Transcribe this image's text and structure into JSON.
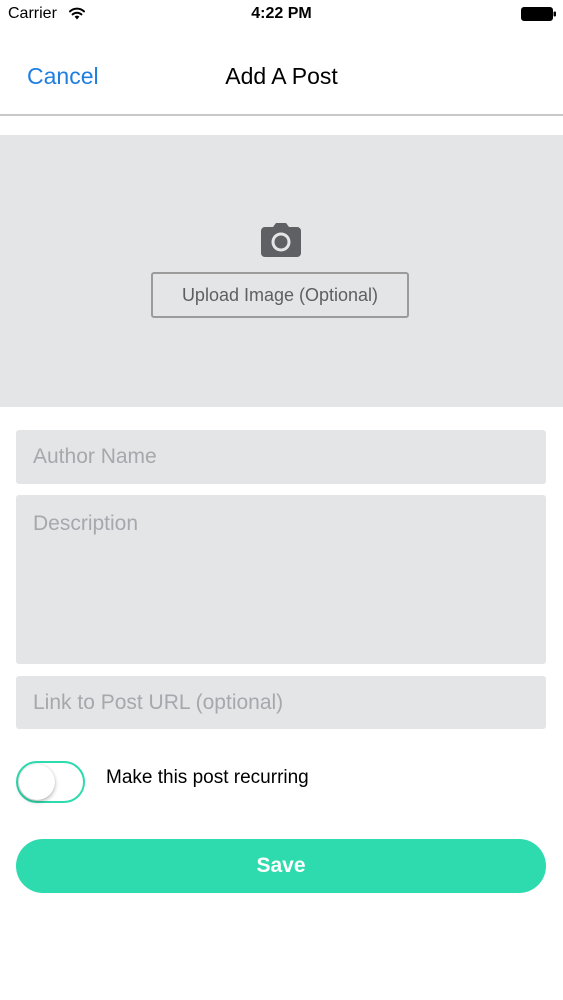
{
  "status_bar": {
    "carrier": "Carrier",
    "time": "4:22 PM",
    "wifi_icon": "wifi-icon",
    "battery_icon": "battery-icon"
  },
  "nav": {
    "cancel_label": "Cancel",
    "title": "Add A Post"
  },
  "image_upload": {
    "icon": "camera-icon",
    "button_label": "Upload Image (Optional)"
  },
  "form": {
    "author": {
      "value": "",
      "placeholder": "Author Name"
    },
    "description": {
      "value": "",
      "placeholder": "Description"
    },
    "link": {
      "value": "",
      "placeholder": "Link to Post URL (optional)"
    }
  },
  "recurring": {
    "label": "Make this post recurring",
    "enabled": false
  },
  "save_label": "Save",
  "colors": {
    "accent": "#2edbae",
    "link_blue": "#1f7ee0",
    "field_background": "#e4e5e7",
    "placeholder": "#a6a8ad"
  }
}
